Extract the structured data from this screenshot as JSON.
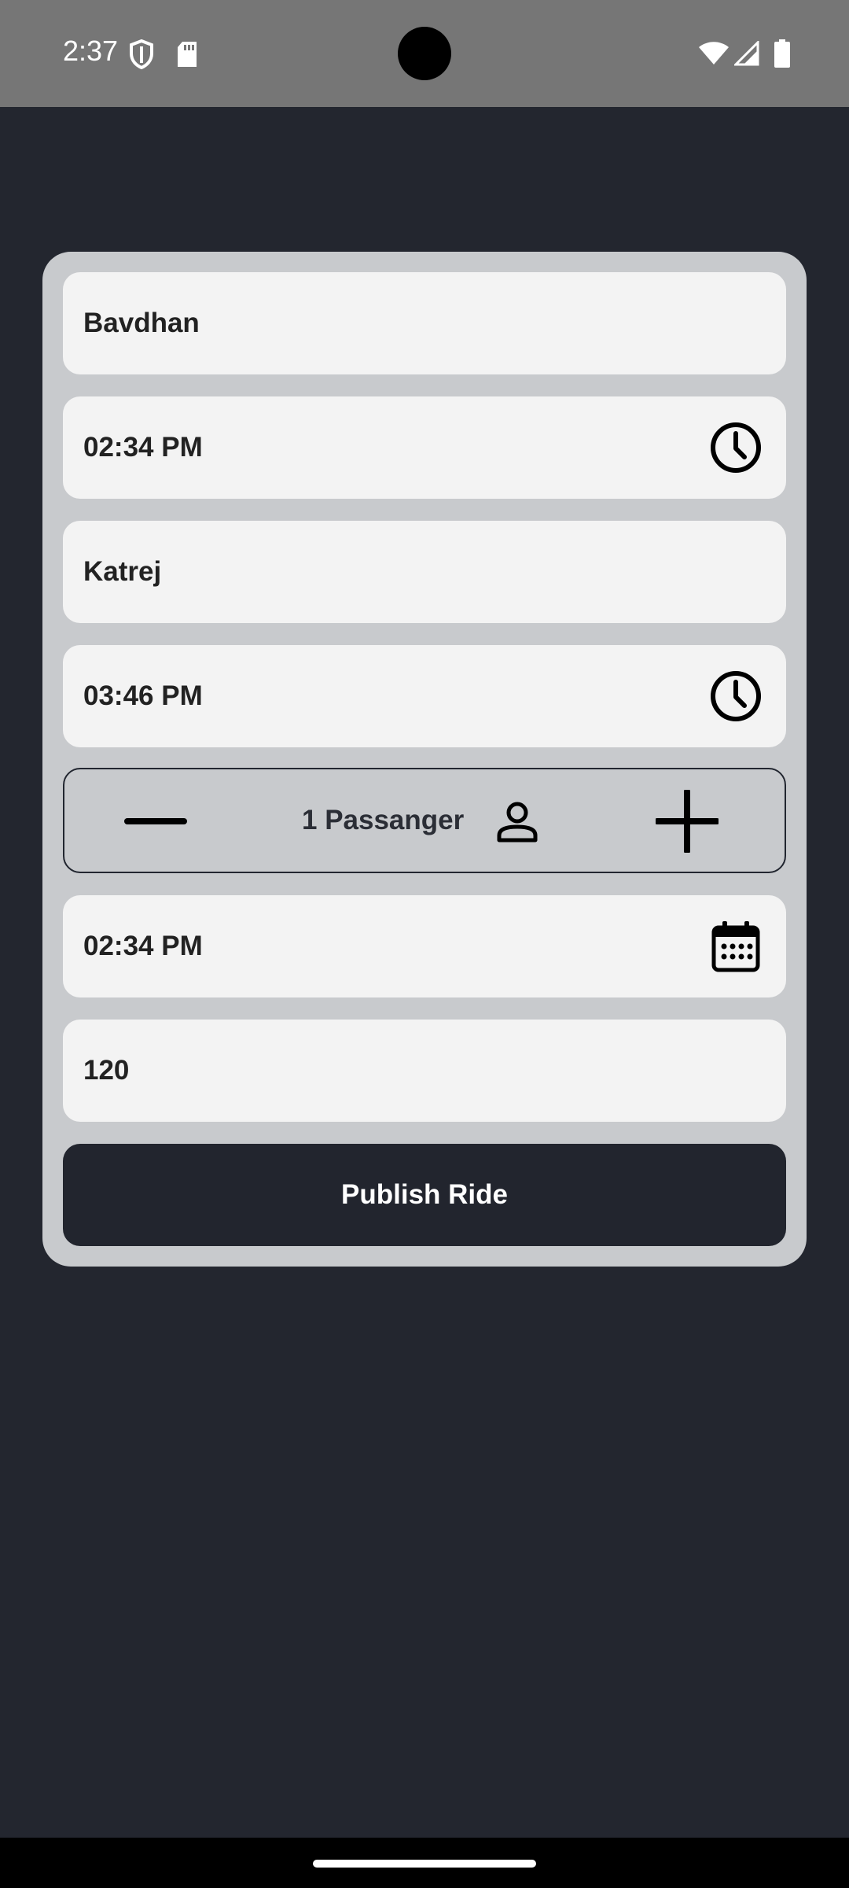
{
  "status_bar": {
    "time": "2:37",
    "icons": [
      "shield-icon",
      "sd-card-icon",
      "wifi-icon",
      "signal-icon",
      "battery-icon"
    ]
  },
  "form": {
    "pickup_location": "Bavdhan",
    "pickup_time": "02:34 PM",
    "drop_location": "Katrej",
    "drop_time": "03:46 PM",
    "passenger_label": "1 Passanger",
    "ride_date": "02:34 PM",
    "fare": "120",
    "publish_label": "Publish Ride"
  },
  "colors": {
    "background": "#23262f",
    "card": "#c8cacd",
    "field": "#f3f3f3",
    "button": "#22252e",
    "status_bar": "#767676"
  }
}
